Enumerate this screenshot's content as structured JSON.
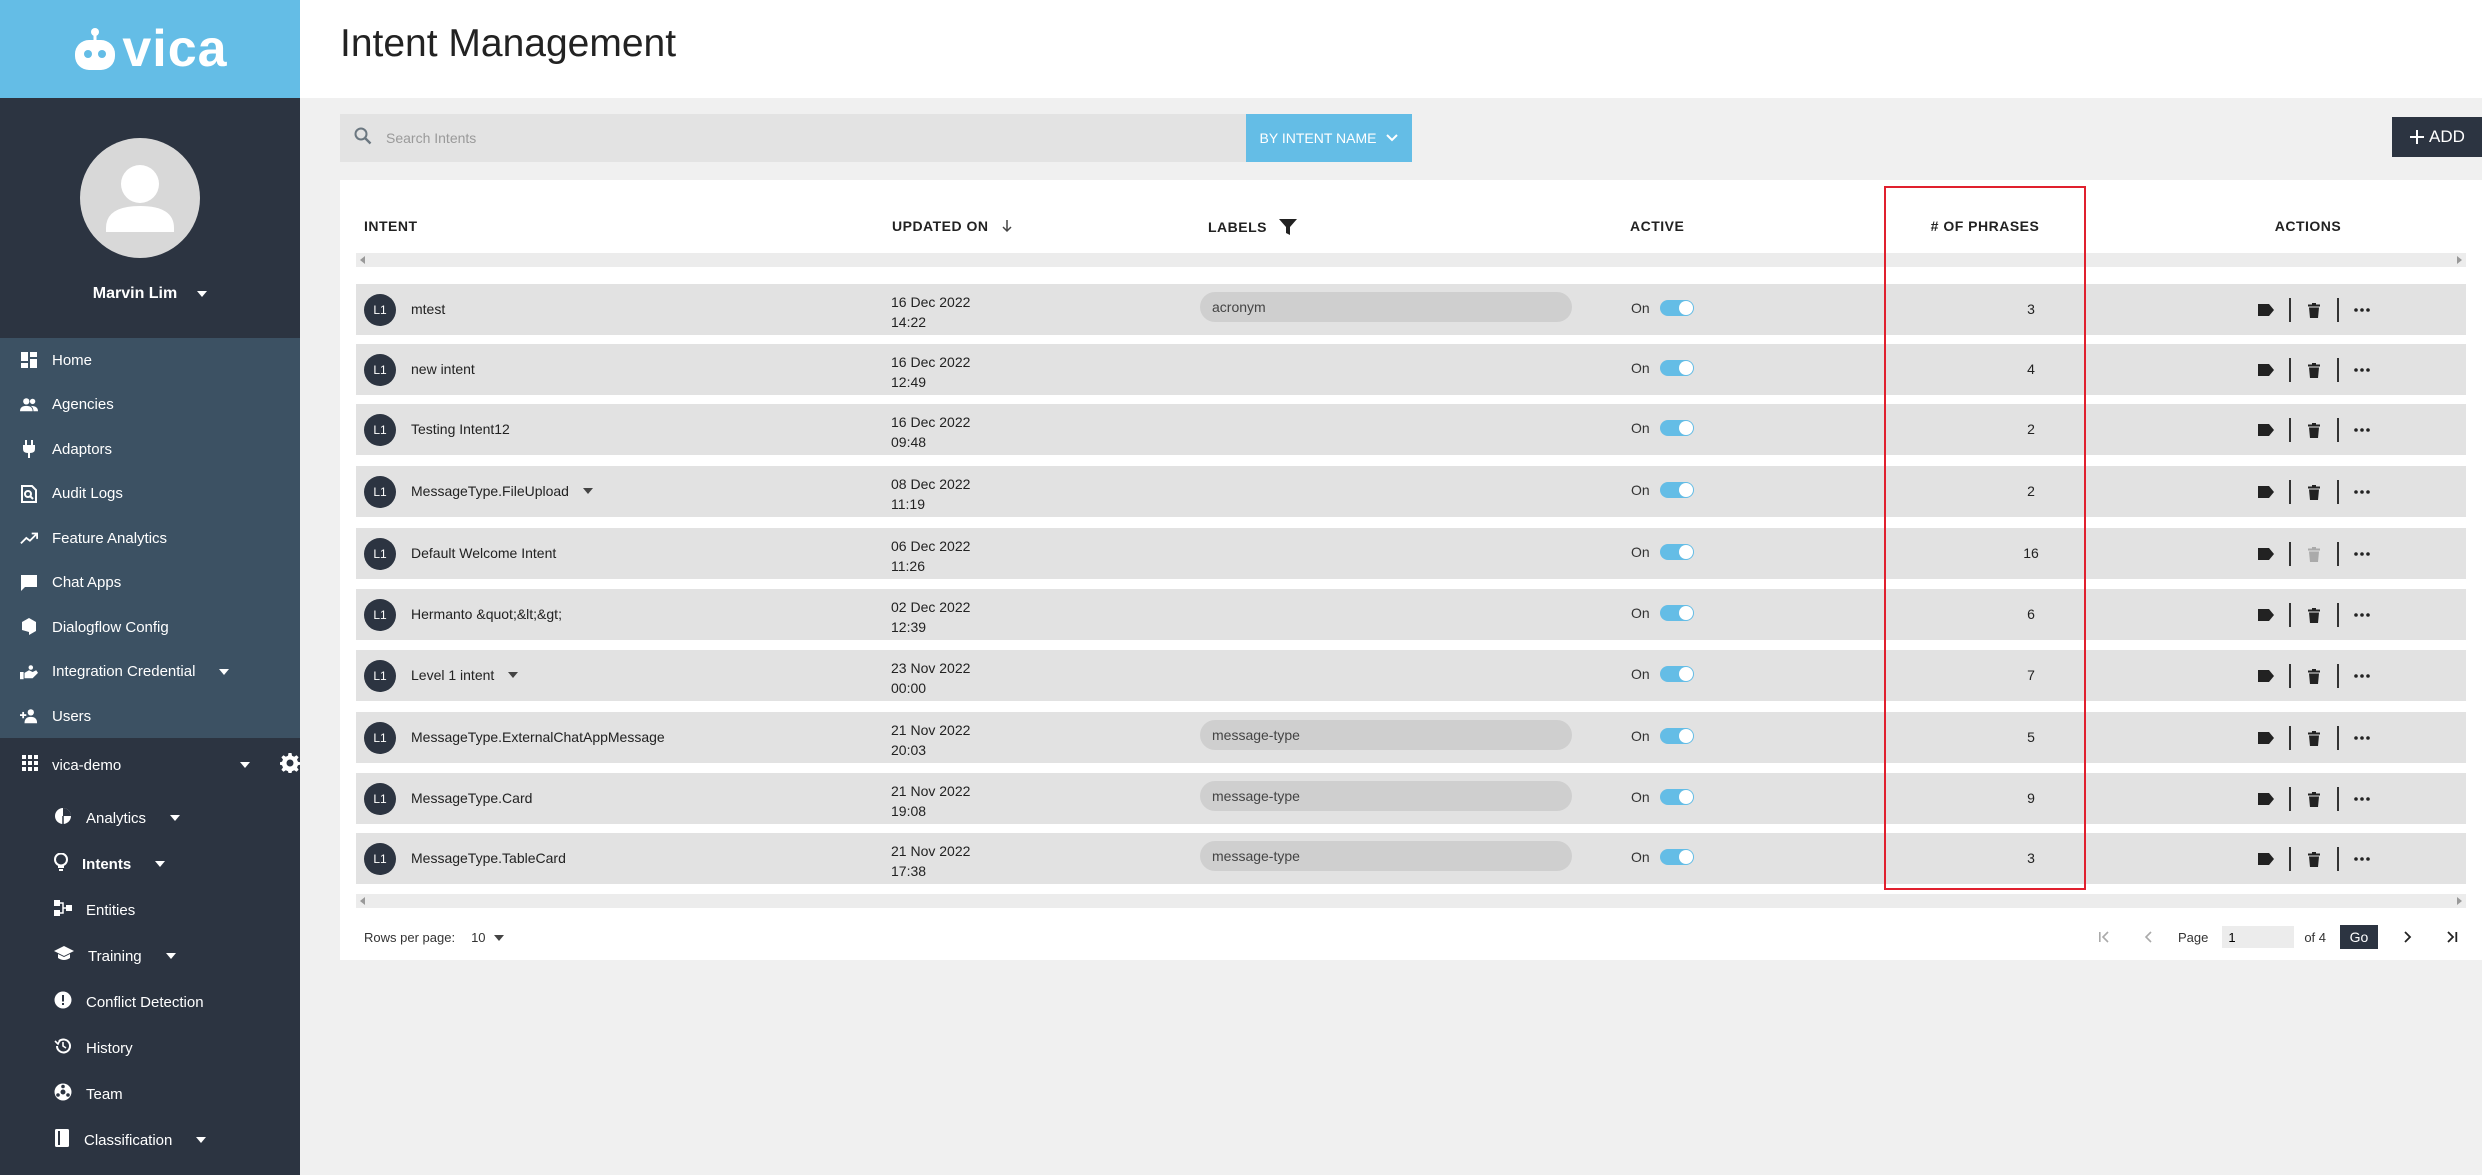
{
  "app": {
    "brand": "vica",
    "accent_color": "#64bde6",
    "sidebar_color": "#2c3441",
    "highlight_color": "#e0202e"
  },
  "profile": {
    "user_name": "Marvin Lim"
  },
  "nav": {
    "primary": [
      {
        "label": "Home",
        "icon": "dashboard-icon"
      },
      {
        "label": "Agencies",
        "icon": "people-icon"
      },
      {
        "label": "Adaptors",
        "icon": "plug-icon"
      },
      {
        "label": "Audit Logs",
        "icon": "search-document-icon"
      },
      {
        "label": "Feature Analytics",
        "icon": "trending-up-icon"
      },
      {
        "label": "Chat Apps",
        "icon": "chat-icon"
      },
      {
        "label": "Dialogflow Config",
        "icon": "dialogflow-icon"
      },
      {
        "label": "Integration Credential",
        "icon": "handshake-icon"
      },
      {
        "label": "Users",
        "icon": "add-user-icon"
      }
    ],
    "workspace": "vica-demo",
    "secondary": [
      {
        "label": "Analytics",
        "icon": "pie-chart-icon",
        "caret": true
      },
      {
        "label": "Intents",
        "icon": "lightbulb-icon",
        "caret": true
      },
      {
        "label": "Entities",
        "icon": "entities-icon",
        "caret": false
      },
      {
        "label": "Training",
        "icon": "school-icon",
        "caret": true
      },
      {
        "label": "Conflict Detection",
        "icon": "alert-icon",
        "caret": false
      },
      {
        "label": "History",
        "icon": "history-icon",
        "caret": false
      },
      {
        "label": "Team",
        "icon": "team-icon",
        "caret": false
      },
      {
        "label": "Classification",
        "icon": "book-icon",
        "caret": true
      }
    ]
  },
  "header": {
    "title": "Intent Management"
  },
  "toolbar": {
    "search_placeholder": "Search Intents",
    "filter_label": "BY INTENT NAME",
    "add_label": "ADD"
  },
  "table": {
    "headers": {
      "intent": "INTENT",
      "updated_on": "UPDATED ON",
      "labels": "LABELS",
      "active": "ACTIVE",
      "phrases": "# OF PHRASES",
      "actions": "ACTIONS"
    },
    "rows": [
      {
        "level": "L1",
        "name": "mtest",
        "date": "16 Dec 2022",
        "time": "14:22",
        "label": "acronym",
        "active": "On",
        "phrases": "3",
        "caret": false,
        "delete_disabled": false
      },
      {
        "level": "L1",
        "name": "new intent",
        "date": "16 Dec 2022",
        "time": "12:49",
        "label": "",
        "active": "On",
        "phrases": "4",
        "caret": false,
        "delete_disabled": false
      },
      {
        "level": "L1",
        "name": "Testing Intent12",
        "date": "16 Dec 2022",
        "time": "09:48",
        "label": "",
        "active": "On",
        "phrases": "2",
        "caret": false,
        "delete_disabled": false
      },
      {
        "level": "L1",
        "name": "MessageType.FileUpload",
        "date": "08 Dec 2022",
        "time": "11:19",
        "label": "",
        "active": "On",
        "phrases": "2",
        "caret": true,
        "delete_disabled": false
      },
      {
        "level": "L1",
        "name": "Default Welcome Intent",
        "date": "06 Dec 2022",
        "time": "11:26",
        "label": "",
        "active": "On",
        "phrases": "16",
        "caret": false,
        "delete_disabled": true
      },
      {
        "level": "L1",
        "name": "Hermanto &quot;&lt;&gt;",
        "date": "02 Dec 2022",
        "time": "12:39",
        "label": "",
        "active": "On",
        "phrases": "6",
        "caret": false,
        "delete_disabled": false
      },
      {
        "level": "L1",
        "name": "Level 1 intent",
        "date": "23 Nov 2022",
        "time": "00:00",
        "label": "",
        "active": "On",
        "phrases": "7",
        "caret": true,
        "delete_disabled": false
      },
      {
        "level": "L1",
        "name": "MessageType.ExternalChatAppMessage",
        "date": "21 Nov 2022",
        "time": "20:03",
        "label": "message-type",
        "active": "On",
        "phrases": "5",
        "caret": false,
        "delete_disabled": false
      },
      {
        "level": "L1",
        "name": "MessageType.Card",
        "date": "21 Nov 2022",
        "time": "19:08",
        "label": "message-type",
        "active": "On",
        "phrases": "9",
        "caret": false,
        "delete_disabled": false
      },
      {
        "level": "L1",
        "name": "MessageType.TableCard",
        "date": "21 Nov 2022",
        "time": "17:38",
        "label": "message-type",
        "active": "On",
        "phrases": "3",
        "caret": false,
        "delete_disabled": false
      }
    ]
  },
  "pagination": {
    "rows_per_page_label": "Rows per page:",
    "rows_per_page": "10",
    "page_label": "Page",
    "current_page": "1",
    "of_label": "of 4",
    "go_label": "Go"
  }
}
